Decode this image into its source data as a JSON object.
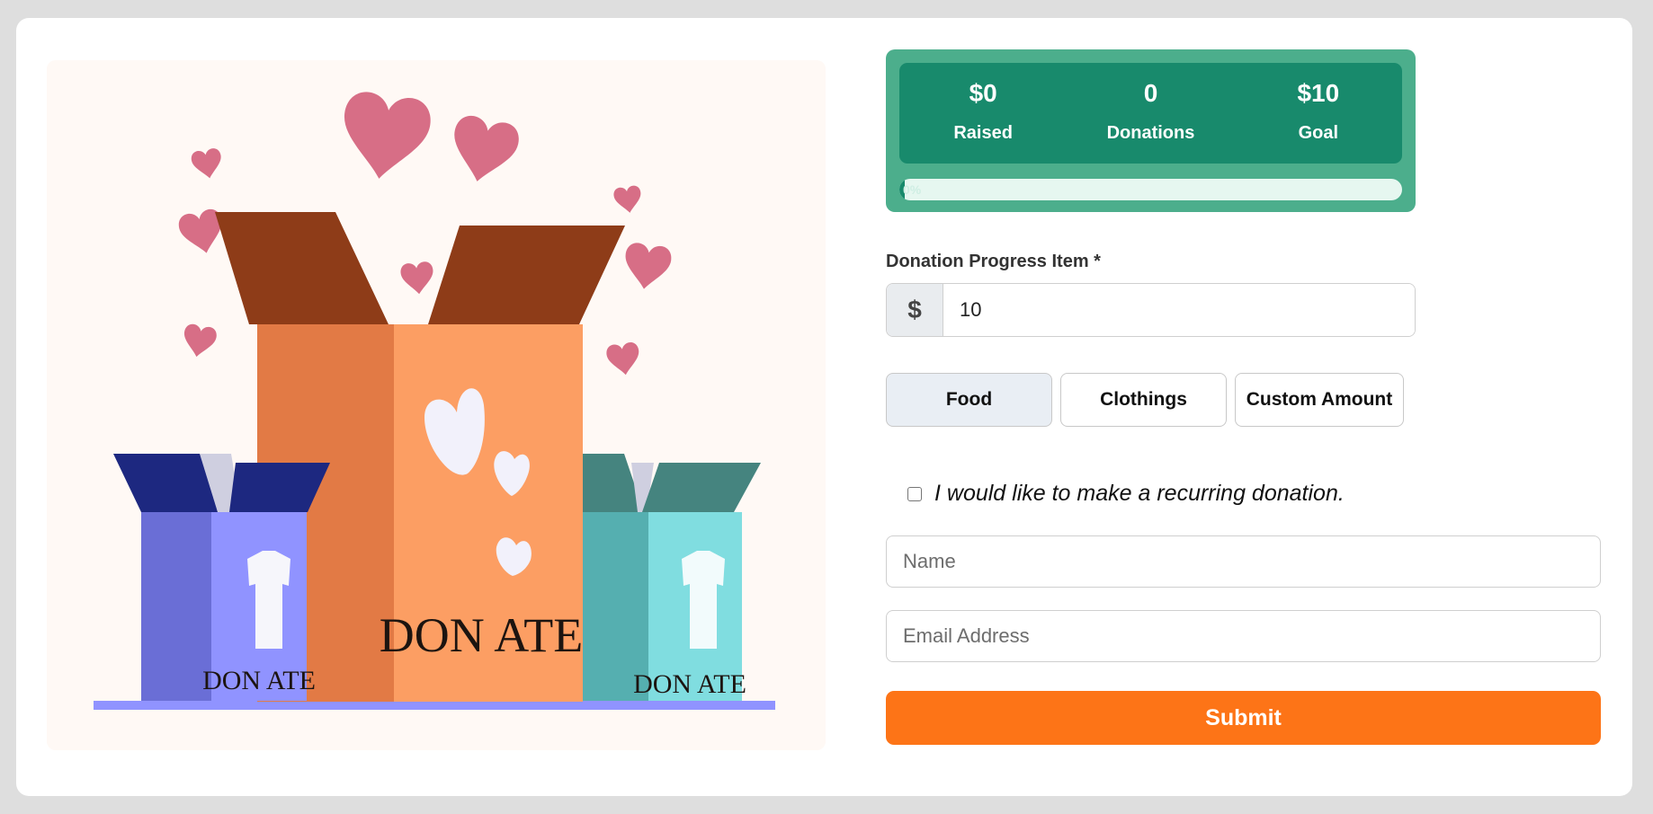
{
  "illustration": {
    "box_text": "DON ATE",
    "colors": {
      "background": "#fff9f5",
      "center_box": "#fc9e63",
      "center_box_side": "#e27a45",
      "center_flaps": "#8e3c18",
      "left_box": "#9093ff",
      "left_box_side": "#6a6ed6",
      "left_flaps": "#1d2880",
      "right_box": "#80dde0",
      "right_box_side": "#55afb0",
      "right_flaps": "#45847f",
      "hearts": "#d76e86"
    }
  },
  "stats": {
    "raised_value": "$0",
    "raised_label": "Raised",
    "donations_value": "0",
    "donations_label": "Donations",
    "goal_value": "$10",
    "goal_label": "Goal",
    "progress_percent": 0,
    "progress_text": "0%",
    "colors": {
      "panel": "#4cae8c",
      "inner": "#188a6c",
      "track": "#e6f7f0"
    }
  },
  "form": {
    "amount_label": "Donation Progress Item *",
    "currency_symbol": "$",
    "amount_value": "10",
    "presets": [
      "Food",
      "Clothings",
      "Custom Amount"
    ],
    "selected_preset": "Food",
    "recurring_label": "I would like to make a recurring donation.",
    "recurring_checked": false,
    "name_placeholder": "Name",
    "email_placeholder": "Email Address",
    "submit_label": "Submit",
    "submit_color": "#fd7417"
  }
}
